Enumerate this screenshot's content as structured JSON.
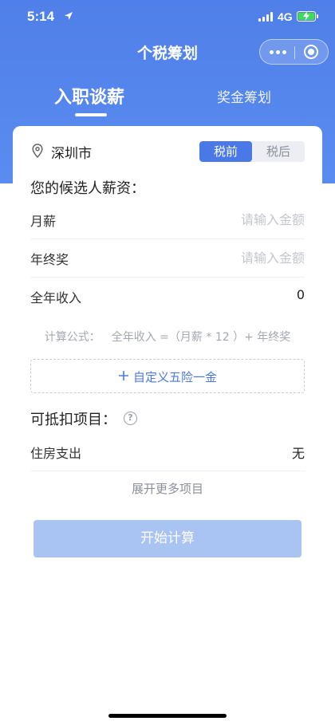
{
  "status_bar": {
    "time": "5:14",
    "network": "4G"
  },
  "nav": {
    "title": "个税筹划"
  },
  "tabs": [
    {
      "label": "入职谈薪",
      "active": true
    },
    {
      "label": "奖金筹划",
      "active": false
    }
  ],
  "location": {
    "city": "深圳市"
  },
  "tax_toggle": {
    "pre": "税前",
    "post": "税后",
    "selected": "税前"
  },
  "salary_section": {
    "title": "您的候选人薪资：",
    "monthly": {
      "label": "月薪",
      "placeholder": "请输入金额"
    },
    "bonus": {
      "label": "年终奖",
      "placeholder": "请输入金额"
    },
    "annual": {
      "label": "全年收入",
      "value": "0"
    },
    "formula_label": "计算公式：",
    "formula": "全年收入 =（月薪 * 12 ）+ 年终奖",
    "custom_insurance": "自定义五险一金"
  },
  "deduction_section": {
    "title": "可抵扣项目：",
    "housing": {
      "label": "住房支出",
      "value": "无"
    },
    "expand": "展开更多项目"
  },
  "start_button": "开始计算",
  "colors": {
    "primary": "#4a78e6",
    "header_bg": "#5a8cf0",
    "button_disabled": "#a9c3f3"
  }
}
